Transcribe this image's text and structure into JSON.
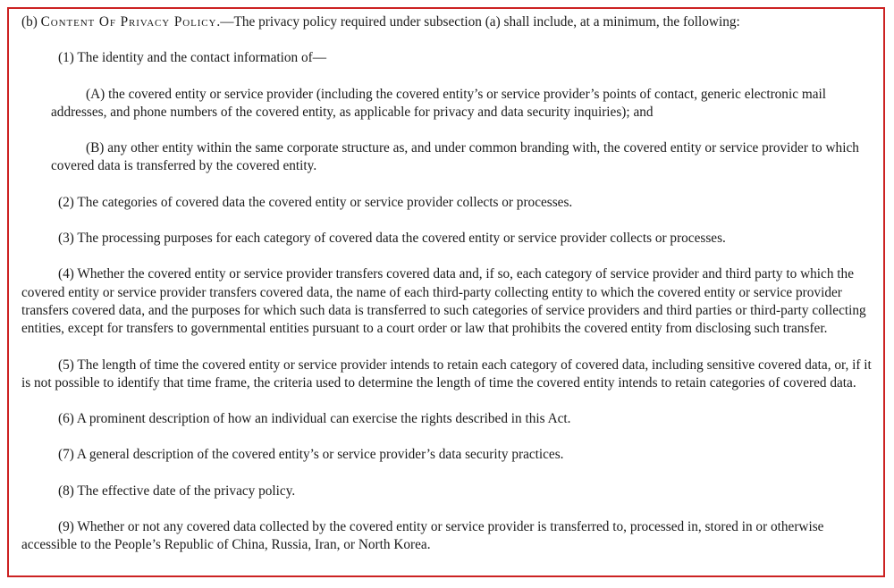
{
  "document": {
    "border_color": "#cc2222",
    "text_color": "#1a1a1a",
    "background_color": "#ffffff",
    "subsection_marker": "(b)",
    "heading_smallcaps": "Content Of Privacy Policy",
    "heading_tail": ".—The privacy policy required under subsection (a) shall include, at a minimum, the following:",
    "paragraphs": [
      {
        "marker": "(1)",
        "level": "number",
        "text": "The identity and the contact information of—"
      },
      {
        "marker": "(A)",
        "level": "letter",
        "text": "the covered entity or service provider (including the covered entity’s or service provider’s points of contact, generic electronic mail addresses, and phone numbers of the covered entity, as applicable for privacy and data security inquiries); and"
      },
      {
        "marker": "(B)",
        "level": "letter",
        "text": "any other entity within the same corporate structure as, and under common branding with, the covered entity or service provider to which covered data is transferred by the covered entity."
      },
      {
        "marker": "(2)",
        "level": "number",
        "text": "The categories of covered data the covered entity or service provider collects or processes."
      },
      {
        "marker": "(3)",
        "level": "number",
        "text": "The processing purposes for each category of covered data the covered entity or service provider collects or processes."
      },
      {
        "marker": "(4)",
        "level": "number",
        "text": "Whether the covered entity or service provider transfers covered data and, if so, each category of service provider and third party to which the covered entity or service provider transfers covered data, the name of each third-party collecting entity to which the covered entity or service provider transfers covered data, and the purposes for which such data is transferred to such categories of service providers and third parties or third-party collecting entities, except for transfers to governmental entities pursuant to a court order or law that prohibits the covered entity from disclosing such transfer."
      },
      {
        "marker": "(5)",
        "level": "number",
        "text": "The length of time the covered entity or service provider intends to retain each category of covered data, including sensitive covered data, or, if it is not possible to identify that time frame, the criteria used to determine the length of time the covered entity intends to retain categories of covered data."
      },
      {
        "marker": "(6)",
        "level": "number",
        "text": "A prominent description of how an individual can exercise the rights described in this Act."
      },
      {
        "marker": "(7)",
        "level": "number",
        "text": "A general description of the covered entity’s or service provider’s data security practices."
      },
      {
        "marker": "(8)",
        "level": "number",
        "text": "The effective date of the privacy policy."
      },
      {
        "marker": "(9)",
        "level": "number",
        "text": "Whether or not any covered data collected by the covered entity or service provider is transferred to, processed in, stored in or otherwise accessible to the People’s Republic of China, Russia, Iran, or North Korea."
      }
    ]
  }
}
